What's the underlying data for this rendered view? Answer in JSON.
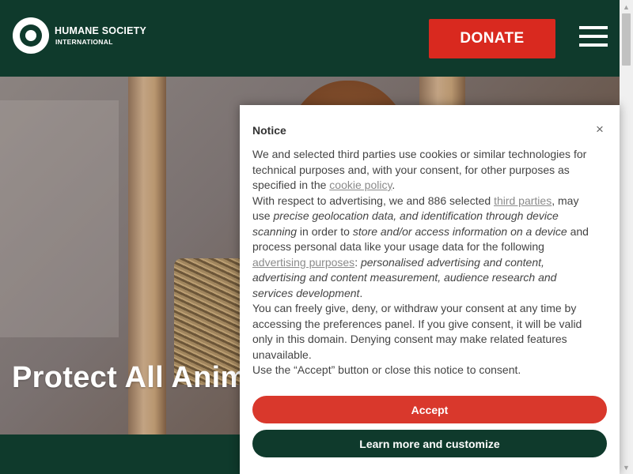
{
  "header": {
    "logo_line1": "HUMANE SOCIETY",
    "logo_line2": "INTERNATIONAL",
    "donate_label": "DONATE"
  },
  "hero": {
    "title": "Protect All Anim"
  },
  "notice": {
    "title": "Notice",
    "close_glyph": "×",
    "p1_a": "We and selected third parties use cookies or similar technologies for technical purposes and, with your consent, for other purposes as specified in the ",
    "p1_link": "cookie policy",
    "p1_b": ".",
    "p2_a": "With respect to advertising, we and 886 selected ",
    "p2_link1": "third parties",
    "p2_b": ", may use ",
    "p2_em1": "precise geolocation data, and identification through device scanning",
    "p2_c": " in order to ",
    "p2_em2": "store and/or access information on a device",
    "p2_d": " and process personal data like your usage data for the following ",
    "p2_link2": "advertising purposes",
    "p2_e": ": ",
    "p2_em3": "personalised advertising and content, advertising and content measurement, audience research and services development",
    "p2_f": ".",
    "p3": "You can freely give, deny, or withdraw your consent at any time by accessing the preferences panel. If you give consent, it will be valid only in this domain. Denying consent may make related features unavailable.",
    "p4": "Use the “Accept” button or close this notice to consent.",
    "accept_label": "Accept",
    "learn_label": "Learn more and customize"
  },
  "scrollbar": {
    "up_glyph": "▲",
    "down_glyph": "▼"
  },
  "colors": {
    "brand_green": "#0f3a2c",
    "donate_red": "#d9291f",
    "accept_red": "#d9382c"
  }
}
